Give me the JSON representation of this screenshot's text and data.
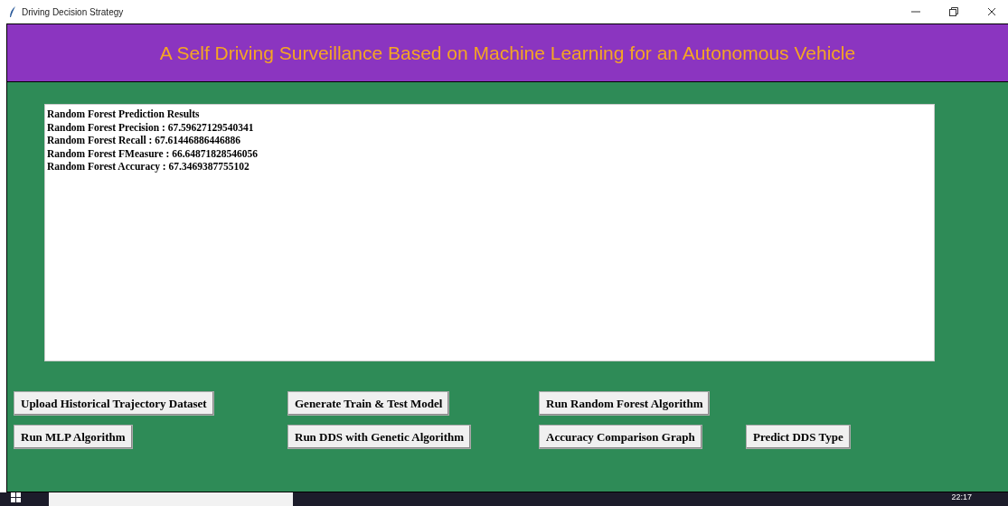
{
  "window": {
    "title": "Driving Decision Strategy"
  },
  "header": {
    "title": "A Self Driving Surveillance Based on Machine Learning for an Autonomous Vehicle"
  },
  "output": {
    "lines": [
      "Random Forest Prediction Results",
      "Random Forest Precision : 67.59627129540341",
      "Random Forest Recall : 67.61446886446886",
      "Random Forest FMeasure : 66.64871828546056",
      "Random Forest Accuracy : 67.3469387755102"
    ]
  },
  "buttons": [
    [
      "Upload Historical Trajectory Dataset",
      "Generate Train & Test Model",
      "Run Random Forest Algorithm"
    ],
    [
      "Run MLP Algorithm",
      "Run DDS with Genetic Algorithm",
      "Accuracy Comparison Graph",
      "Predict DDS Type"
    ]
  ],
  "taskbar": {
    "clock": "22:17"
  }
}
